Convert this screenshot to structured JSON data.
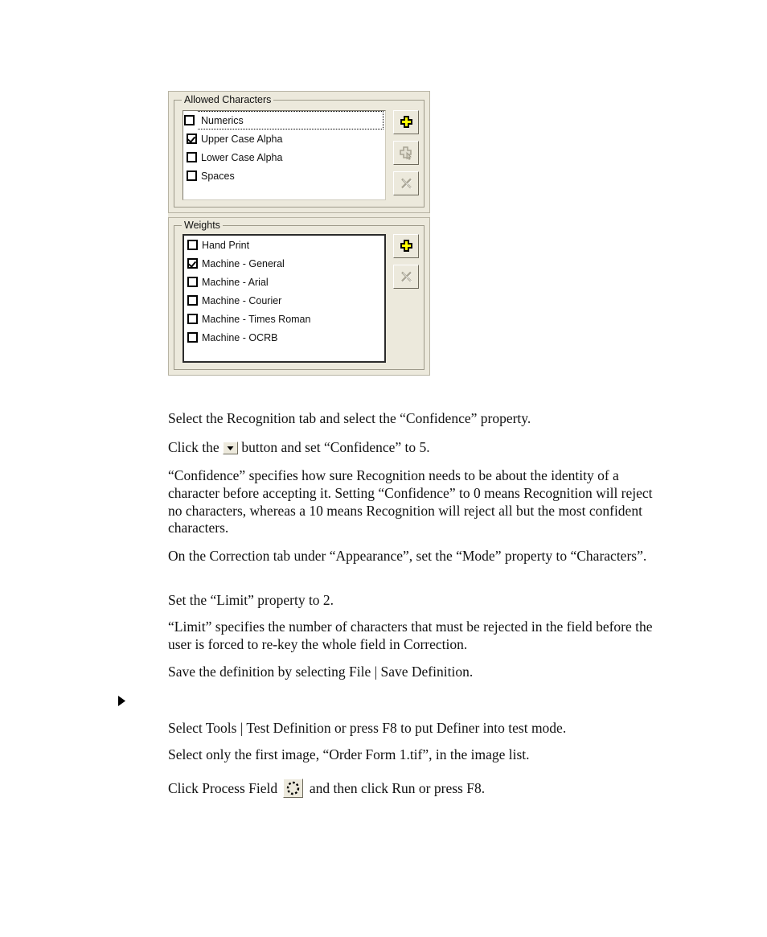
{
  "figure": {
    "allowed_characters": {
      "group_title": "Allowed Characters",
      "items": [
        {
          "label": "Numerics",
          "checked": false,
          "focused": true
        },
        {
          "label": "Upper Case Alpha",
          "checked": true,
          "focused": false
        },
        {
          "label": "Lower Case Alpha",
          "checked": false,
          "focused": false
        },
        {
          "label": "Spaces",
          "checked": false,
          "focused": false
        }
      ],
      "buttons": [
        {
          "name": "add-button",
          "icon": "plus-icon",
          "enabled": true
        },
        {
          "name": "modify-button",
          "icon": "plus-cursor-icon",
          "enabled": false
        },
        {
          "name": "delete-button",
          "icon": "close-x-icon",
          "enabled": false
        }
      ]
    },
    "weights": {
      "group_title": "Weights",
      "items": [
        {
          "label": "Hand Print",
          "checked": false
        },
        {
          "label": "Machine - General",
          "checked": true
        },
        {
          "label": "Machine - Arial",
          "checked": false
        },
        {
          "label": "Machine - Courier",
          "checked": false
        },
        {
          "label": "Machine - Times Roman",
          "checked": false
        },
        {
          "label": "Machine - OCRB",
          "checked": false
        }
      ],
      "buttons": [
        {
          "name": "add-button",
          "icon": "plus-icon",
          "enabled": true
        },
        {
          "name": "delete-button",
          "icon": "close-x-icon",
          "enabled": false
        }
      ]
    },
    "colors": {
      "dialog_background": "#ece9dc",
      "listbox_background": "#ffffff",
      "plus_icon_fill": "#ffff00",
      "plus_icon_outline": "#000000",
      "disabled_icon": "#a8a494",
      "group_border": "#9e9a8a"
    }
  },
  "body": {
    "p1": "Select the Recognition tab and select the “Confidence” property.",
    "p2_before": "Click the",
    "p2_after": "button and set “Confidence” to 5.",
    "p3": "“Confidence” specifies how sure Recognition needs to be about the identity of a character before accepting it. Setting “Confidence” to 0 means Recognition will reject no characters, whereas a 10 means Recognition will reject all but the most confident characters.",
    "p4": "On the Correction tab under “Appearance”, set the “Mode” property to “Characters”.",
    "p5": "Set the “Limit” property to 2.",
    "p6": "“Limit” specifies the number of characters that must be rejected in the field before the user is forced to re-key the whole field in Correction.",
    "p7": "Save the definition by selecting File | Save Definition.",
    "p8": "Select Tools | Test Definition or press F8 to put Definer into test mode.",
    "p9": "Select only the first image, “Order Form 1.tif”, in the image list.",
    "p10_before": "Click Process Field",
    "p10_after": "and then click Run or press F8."
  }
}
